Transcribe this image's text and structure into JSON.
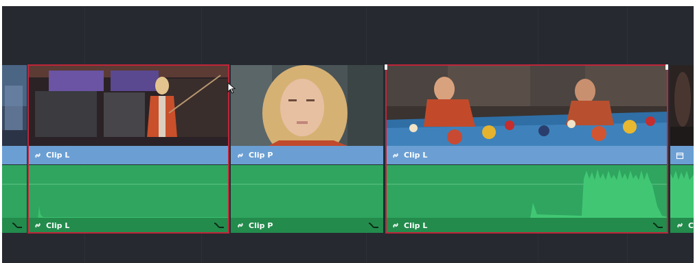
{
  "timeline": {
    "video_clips": [
      {
        "label": "",
        "kind": "partial-left"
      },
      {
        "label": "Clip L",
        "kind": "scene-billiards-lean"
      },
      {
        "label": "Clip P",
        "kind": "scene-portrait"
      },
      {
        "label": "Clip L",
        "kind": "scene-pool-table"
      },
      {
        "label": "",
        "kind": "partial-right"
      }
    ],
    "audio_clips": [
      {
        "label": ""
      },
      {
        "label": "Clip L"
      },
      {
        "label": "Clip P"
      },
      {
        "label": "Clip L"
      },
      {
        "label": "C"
      }
    ],
    "icons": {
      "link": "link-icon",
      "fade": "audio-fade-icon",
      "calendar": "calendar-icon",
      "cursor": "mouse-cursor-icon"
    },
    "colors": {
      "background": "#262930",
      "video_label": "#6b9fd3",
      "audio_body": "#2fa55f",
      "audio_label": "#238b4c",
      "selection": "#c0253a"
    }
  }
}
